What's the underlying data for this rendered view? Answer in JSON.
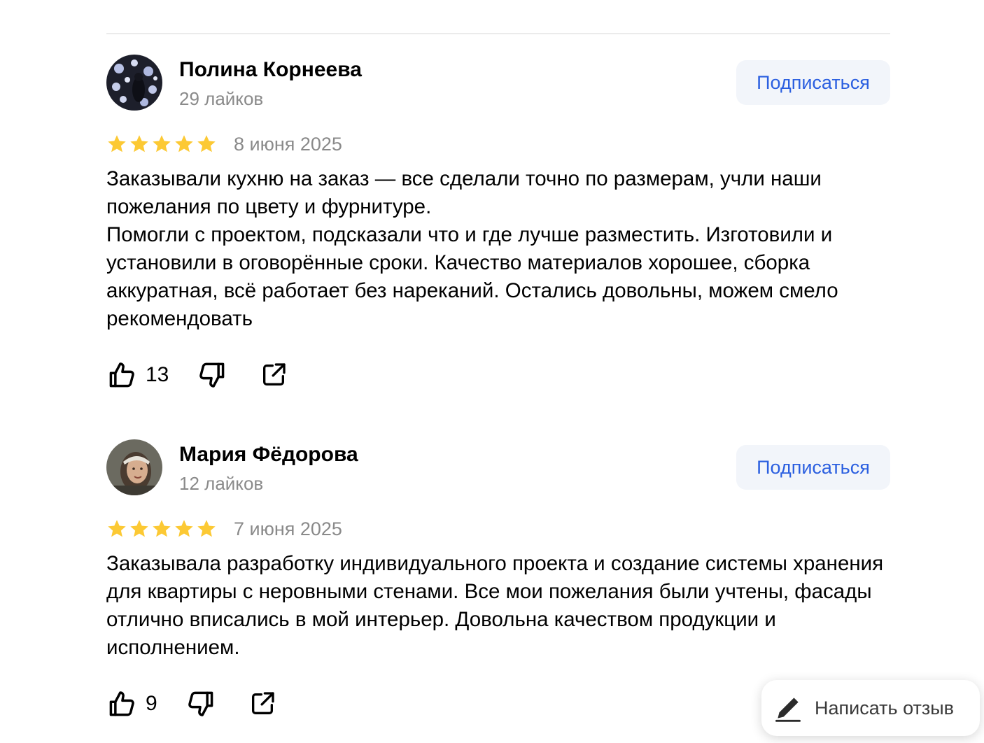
{
  "reviews": [
    {
      "author_name": "Полина Корнеева",
      "author_likes": "29 лайков",
      "subscribe_label": "Подписаться",
      "rating": 5,
      "date": "8 июня 2025",
      "text": [
        "Заказывали кухню на заказ — все сделали точно по размерам, учли наши пожелания по цвету и фурнитуре.",
        "Помогли с проектом, подсказали что и где лучше разместить. Изготовили и установили в оговорённые сроки. Качество материалов хорошее, сборка аккуратная, всё работает без нареканий. Остались довольны, можем смело рекомендовать"
      ],
      "like_count": "13"
    },
    {
      "author_name": "Мария Фёдорова",
      "author_likes": "12 лайков",
      "subscribe_label": "Подписаться",
      "rating": 5,
      "date": "7 июня 2025",
      "text": [
        "Заказывала разработку индивидуального проекта и создание системы хранения для квартиры с неровными стенами. Все мои пожелания были учтены, фасады отлично вписались в мой интерьер. Довольна качеством продукции и исполнением."
      ],
      "like_count": "9"
    }
  ],
  "write_review": {
    "label": "Написать отзыв",
    "icon": "pencil-icon"
  },
  "icons": {
    "like": "thumbs-up-icon",
    "dislike": "thumbs-down-icon",
    "share": "share-icon",
    "star": "star-icon"
  },
  "colors": {
    "accent": "#2b5fe0",
    "star": "#fcc934",
    "muted": "#8a8a8a",
    "button_bg": "#f2f5fa"
  }
}
